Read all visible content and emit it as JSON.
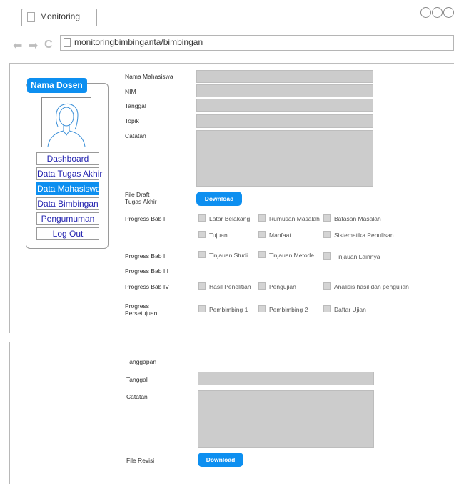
{
  "browser": {
    "tab_title": "Monitoring",
    "url": "monitoringbimbinganta/bimbingan"
  },
  "sidebar": {
    "header": "Nama Dosen",
    "items": [
      {
        "label": "Dashboard",
        "active": false
      },
      {
        "label": "Data Tugas Akhir",
        "active": false
      },
      {
        "label": "Data Mahasiswa",
        "active": true
      },
      {
        "label": "Data Bimbingan",
        "active": false
      },
      {
        "label": "Pengumuman",
        "active": false
      },
      {
        "label": "Log Out",
        "active": false
      }
    ]
  },
  "form": {
    "nama_label": "Nama Mahasiswa",
    "nim_label": "NIM",
    "tanggal_label": "Tanggal",
    "topik_label": "Topik",
    "catatan_label": "Catatan",
    "file_draft_label_1": "File Draft",
    "file_draft_label_2": "Tugas Akhir",
    "download_label": "Download",
    "bab1_label": "Progress Bab I",
    "bab1_options": [
      "Latar Belakang",
      "Rumusan Masalah",
      "Batasan Masalah",
      "Tujuan",
      "Manfaat",
      "Sistematika Penulisan"
    ],
    "bab2_label": "Progress Bab II",
    "bab2_options": [
      "Tinjauan Studi",
      "Tinjauan Metode",
      "Tinjauan Lainnya"
    ],
    "bab3_label": "Progress Bab III",
    "bab4_label": "Progress Bab IV",
    "bab4_options": [
      "Hasil Penelitian",
      "Pengujian",
      "Analisis hasil dan pengujian"
    ],
    "persetujuan_label_1": "Progress",
    "persetujuan_label_2": "Persetujuan",
    "persetujuan_options": [
      "Pembimbing 1",
      "Pembimbing 2",
      "Daftar Ujian"
    ]
  },
  "tanggapan": {
    "title": "Tanggapan",
    "tanggal_label": "Tanggal",
    "catatan_label": "Catatan",
    "file_revisi_label": "File Revisi",
    "download_label": "Download"
  },
  "colors": {
    "accent": "#0d8ff0",
    "field": "#cccccc",
    "menu_text": "#2323b0"
  }
}
